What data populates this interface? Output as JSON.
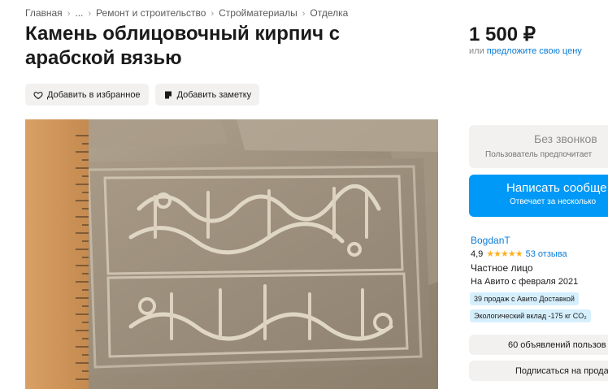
{
  "breadcrumbs": [
    "Главная",
    "...",
    "Ремонт и строительство",
    "Стройматериалы",
    "Отделка"
  ],
  "breadcrumb_separator": "›",
  "title": "Камень облицовочный кирпич с арабской вязью",
  "actions": {
    "favorite_label": "Добавить в избранное",
    "favorite_icon": "heart-icon",
    "note_label": "Добавить заметку",
    "note_icon": "note-icon"
  },
  "photo": {
    "description_icon": "product-photo"
  },
  "price": {
    "value": "1 500 ₽",
    "or_text": "или",
    "offer_link": "предложите свою цену"
  },
  "contact": {
    "no_calls_title": "Без звонков",
    "no_calls_sub": "Пользователь предпочитает",
    "write_title": "Написать сообще",
    "write_sub": "Отвечает за несколько"
  },
  "seller": {
    "name": "BogdanT",
    "rating": "4,9",
    "stars": "★★★★★",
    "reviews": "53 отзыва",
    "type": "Частное лицо",
    "since": "На Авито с февраля 2021",
    "badges": [
      "39 продаж с Авито Доставкой",
      "Экологический вклад -175 кг CO₂"
    ],
    "listings_button": "60 объявлений пользов",
    "subscribe_button": "Подписаться на прода"
  },
  "colors": {
    "accent": "#0099f7",
    "link": "#0a7bd6",
    "star": "#ffb021",
    "badge_bg": "#d6effd",
    "button_bg": "#f2f1f0"
  }
}
